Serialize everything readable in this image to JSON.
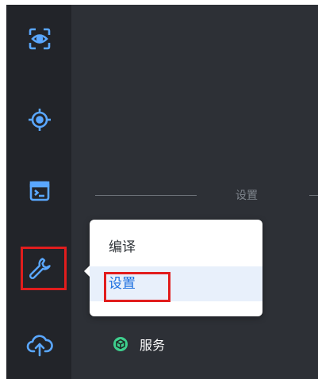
{
  "sidebar": {
    "items": [
      {
        "icon": "scan-eye-icon"
      },
      {
        "icon": "target-icon"
      },
      {
        "icon": "terminal-icon"
      },
      {
        "icon": "wrench-icon",
        "highlighted": true
      },
      {
        "icon": "cloud-upload-icon"
      }
    ]
  },
  "section": {
    "divider_label": "设置"
  },
  "services": {
    "label": "服务",
    "icon": "service-cube-icon",
    "icon_color": "#3ecf8e"
  },
  "popup_menu": {
    "items": [
      {
        "label": "编译",
        "active": false
      },
      {
        "label": "设置",
        "active": true,
        "highlighted": true
      }
    ]
  },
  "colors": {
    "accent": "#1c6fe0",
    "highlight_box": "#e11d1d",
    "icon": "#5aa7ff"
  }
}
